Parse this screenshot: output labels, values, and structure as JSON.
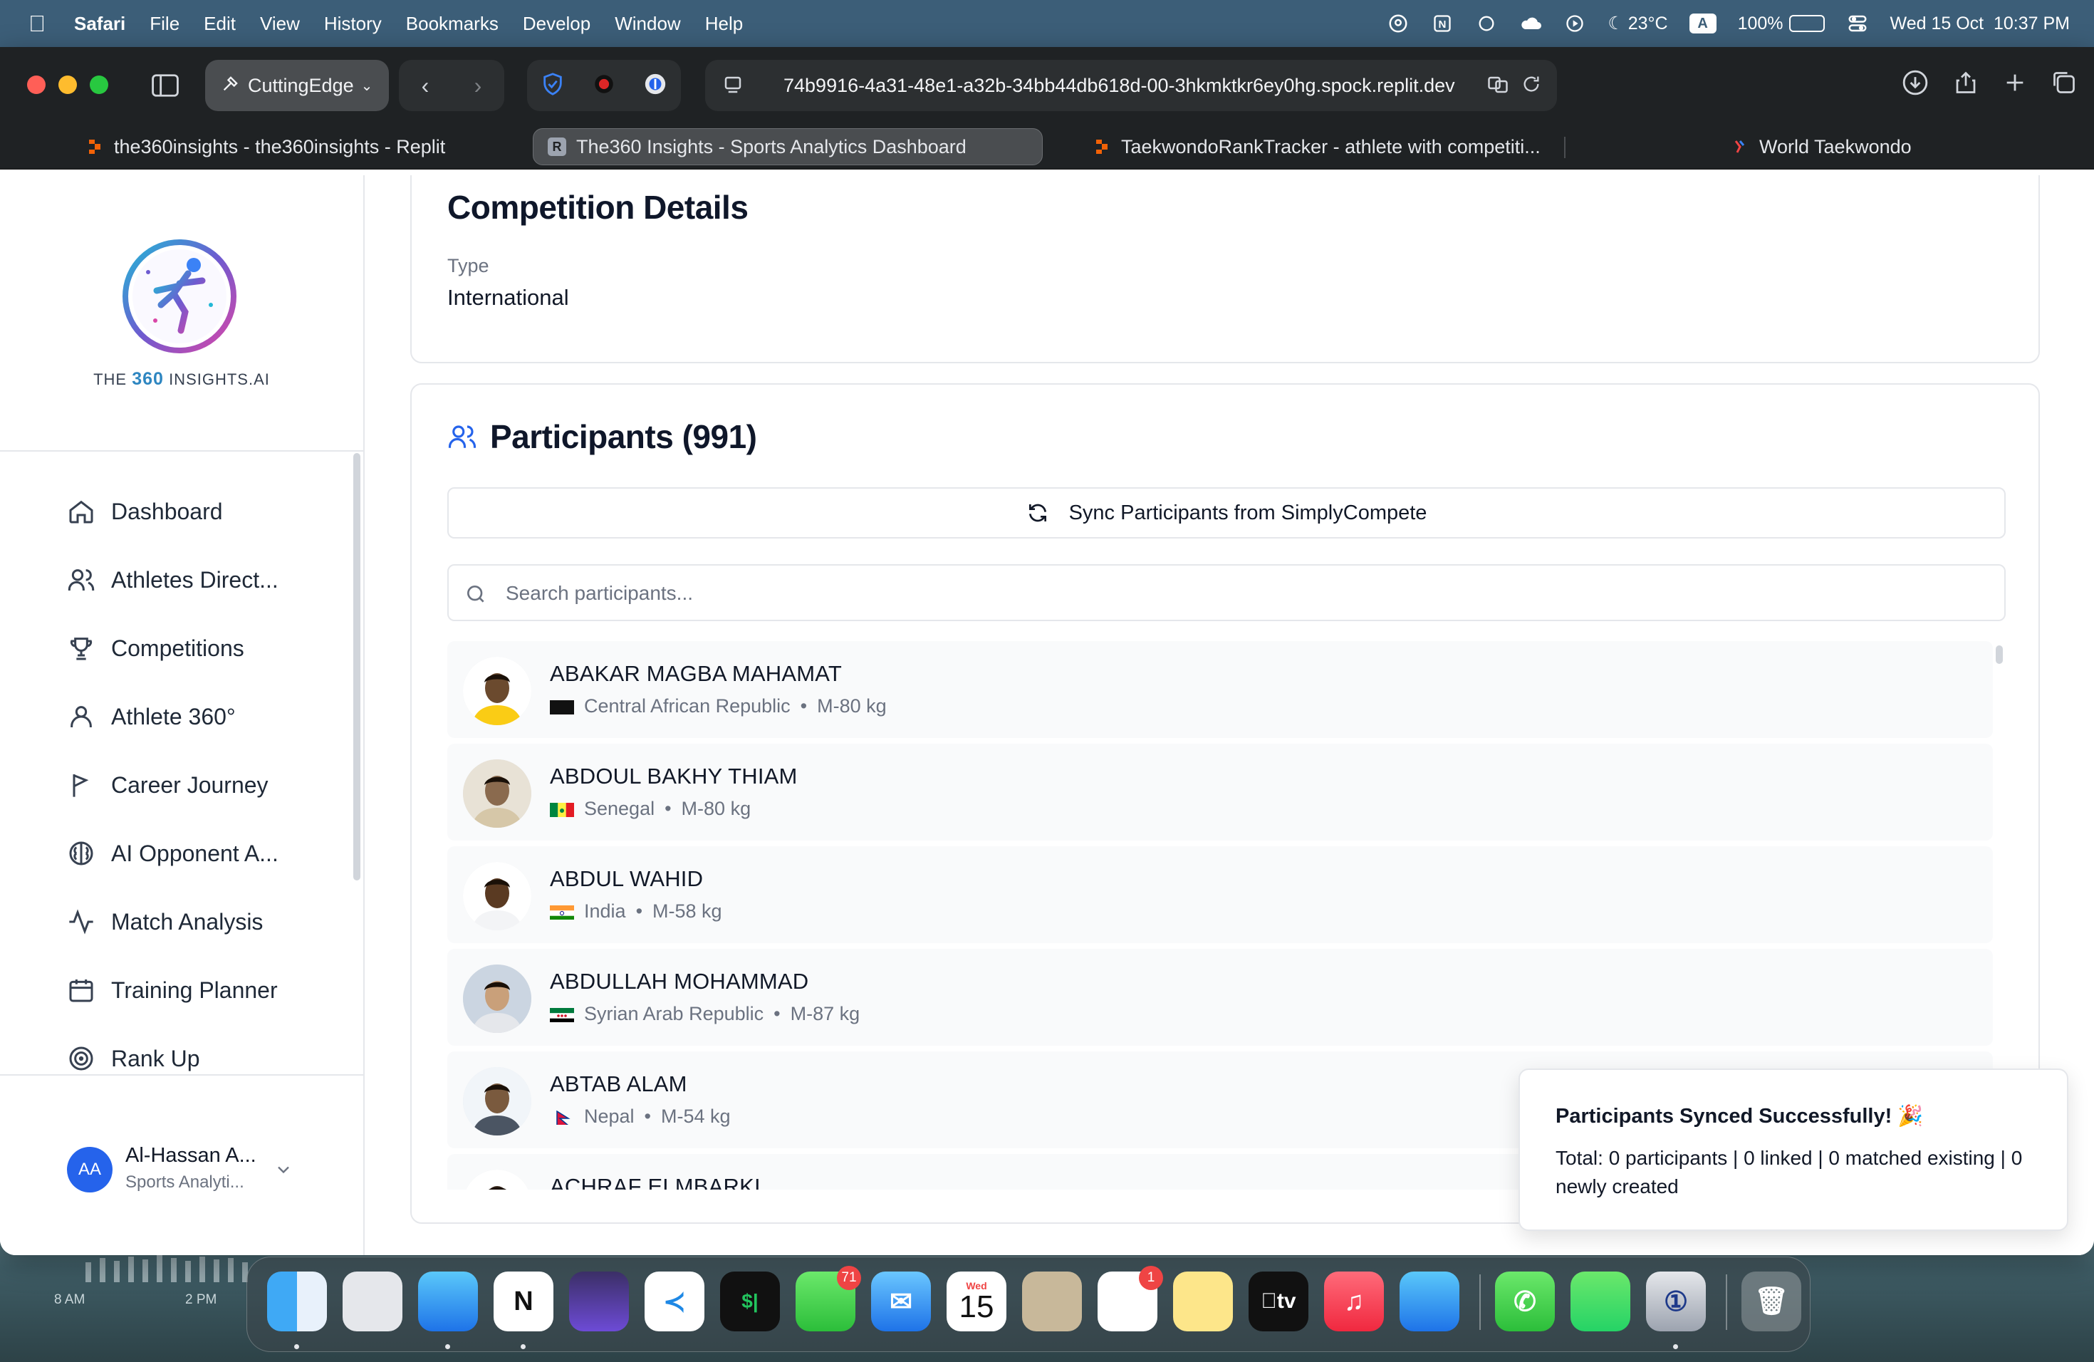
{
  "menubar": {
    "app": "Safari",
    "items": [
      "File",
      "Edit",
      "View",
      "History",
      "Bookmarks",
      "Develop",
      "Window",
      "Help"
    ],
    "weather": "23°C",
    "input_badge": "A",
    "battery": "100%",
    "battery_level": 1.0,
    "datetime": "Wed 15 Oct  10:37 PM"
  },
  "toolbar": {
    "profile": "CuttingEdge",
    "url": "74b9916-4a31-48e1-a32b-34bb44db618d-00-3hkmktkr6ey0hg.spock.replit.dev"
  },
  "tabs": [
    {
      "title": "the360insights - the360insights - Replit",
      "icon": "replit-icon"
    },
    {
      "title": "The360 Insights - Sports Analytics Dashboard",
      "icon": "r-icon",
      "fav": "R"
    },
    {
      "title": "TaekwondoRankTracker - athlete with competiti...",
      "icon": "replit-icon"
    },
    {
      "title": "World Taekwondo",
      "icon": "wt-icon"
    }
  ],
  "sidebar": {
    "logo_text_pre": "THE ",
    "logo_text_num": "360",
    "logo_text_post": " INSIGHTS.AI",
    "items": [
      {
        "label": "Dashboard",
        "icon": "home-icon"
      },
      {
        "label": "Athletes Direct...",
        "icon": "users-icon"
      },
      {
        "label": "Competitions",
        "icon": "trophy-icon"
      },
      {
        "label": "Athlete 360°",
        "icon": "user-icon"
      },
      {
        "label": "Career Journey",
        "icon": "flag-icon"
      },
      {
        "label": "AI Opponent A...",
        "icon": "brain-icon"
      },
      {
        "label": "Match Analysis",
        "icon": "activity-icon"
      },
      {
        "label": "Training Planner",
        "icon": "calendar-icon"
      },
      {
        "label": "Rank Up",
        "icon": "target-icon"
      }
    ],
    "user": {
      "initials": "AA",
      "name": "Al-Hassan A...",
      "role": "Sports Analyti..."
    }
  },
  "competition": {
    "title": "Competition Details",
    "type_label": "Type",
    "type_value": "International"
  },
  "participants": {
    "title": "Participants (991)",
    "sync_label": "Sync Participants from SimplyCompete",
    "search_placeholder": "Search participants...",
    "rows": [
      {
        "name": "ABAKAR MAGBA MAHAMAT",
        "country": "Central African Republic",
        "category": "M-80 kg",
        "flag": "black"
      },
      {
        "name": "ABDOUL BAKHY THIAM",
        "country": "Senegal",
        "category": "M-80 kg",
        "flag": "senegal"
      },
      {
        "name": "ABDUL WAHID",
        "country": "India",
        "category": "M-58 kg",
        "flag": "india"
      },
      {
        "name": "ABDULLAH MOHAMMAD",
        "country": "Syrian Arab Republic",
        "category": "M-87 kg",
        "flag": "syria"
      },
      {
        "name": "ABTAB ALAM",
        "country": "Nepal",
        "category": "M-54 kg",
        "flag": "nepal"
      },
      {
        "name": "ACHRAF ELMBARKI",
        "country": "",
        "category": "",
        "flag": ""
      }
    ],
    "separator": "•"
  },
  "toast": {
    "title": "Participants Synced Successfully! 🎉",
    "description": "Total: 0 participants | 0 linked | 0 matched existing | 0 newly created"
  },
  "desktop_widget": {
    "t1": "8 AM",
    "t2": "2 PM"
  },
  "dock": {
    "apps": [
      "finder",
      "launchpad",
      "safari",
      "notion",
      "obsidian",
      "vscode",
      "terminal",
      "messages",
      "mail",
      "calendar",
      "contacts",
      "reminders",
      "notes",
      "appletv",
      "music",
      "appstore",
      "phone",
      "whatsapp",
      "1password",
      "trash"
    ],
    "messages_badge": "71",
    "reminders_badge": "1",
    "calendar_month": "Wed",
    "calendar_day": "15",
    "tv_label": "tv"
  },
  "colors": {
    "accent": "#2563eb",
    "menubar": "#3c5e78",
    "toolbar": "#1f2224"
  }
}
